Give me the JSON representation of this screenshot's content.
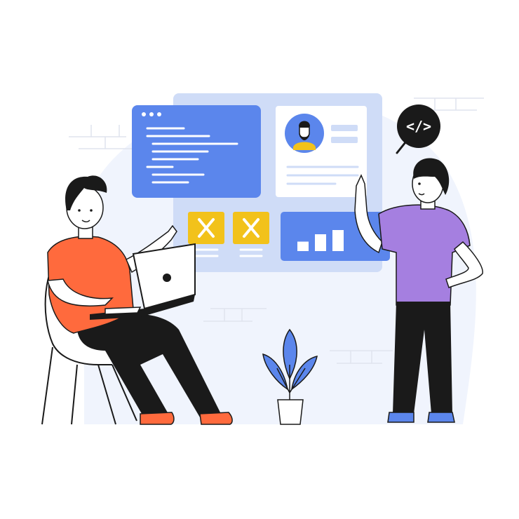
{
  "illustration": {
    "code_badge": {
      "text": "</>"
    },
    "bar_chart": {
      "bars": [
        0.45,
        0.8,
        1.0
      ]
    }
  },
  "colors": {
    "background_blob": "#f0f4fd",
    "back_panel": "#cfdcf7",
    "accent_blue": "#5b86ec",
    "accent_yellow": "#f2c21b",
    "shirt_orange": "#ff6a3d",
    "shirt_purple": "#a57fe0",
    "outline": "#1a1a1a",
    "brick_lines": "#dfe3ee"
  }
}
